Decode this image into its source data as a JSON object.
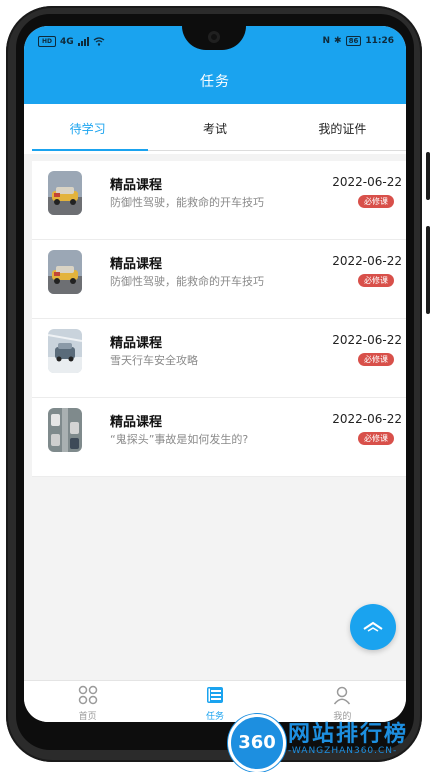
{
  "status_bar": {
    "left_sim": "HD",
    "left_net": "4G",
    "right_nfc": "N",
    "right_bt": "✱",
    "battery": "86",
    "time": "11:26"
  },
  "header": {
    "title": "任务"
  },
  "tabs": [
    {
      "label": "待学习",
      "active": true
    },
    {
      "label": "考试",
      "active": false
    },
    {
      "label": "我的证件",
      "active": false
    }
  ],
  "courses": [
    {
      "title": "精品课程",
      "subtitle": "防御性驾驶，能救命的开车技巧",
      "date": "2022-06-22",
      "badge": "必修课"
    },
    {
      "title": "精品课程",
      "subtitle": "防御性驾驶，能救命的开车技巧",
      "date": "2022-06-22",
      "badge": "必修课"
    },
    {
      "title": "精品课程",
      "subtitle": "雪天行车安全攻略",
      "date": "2022-06-22",
      "badge": "必修课"
    },
    {
      "title": "精品课程",
      "subtitle": "“鬼探头”事故是如何发生的?",
      "date": "2022-06-22",
      "badge": "必修课"
    }
  ],
  "fab": {
    "icon": "collapse-up-icon"
  },
  "bottom_nav": [
    {
      "label": "首页",
      "icon": "grid-icon",
      "active": false
    },
    {
      "label": "任务",
      "icon": "task-icon",
      "active": true
    },
    {
      "label": "我的",
      "icon": "user-icon",
      "active": false
    }
  ],
  "watermark": {
    "logo": "360",
    "name": "网站排行榜",
    "url": "-WANGZHAN360.CN-"
  },
  "colors": {
    "primary": "#1aa3ef",
    "badge": "#d8504a"
  }
}
